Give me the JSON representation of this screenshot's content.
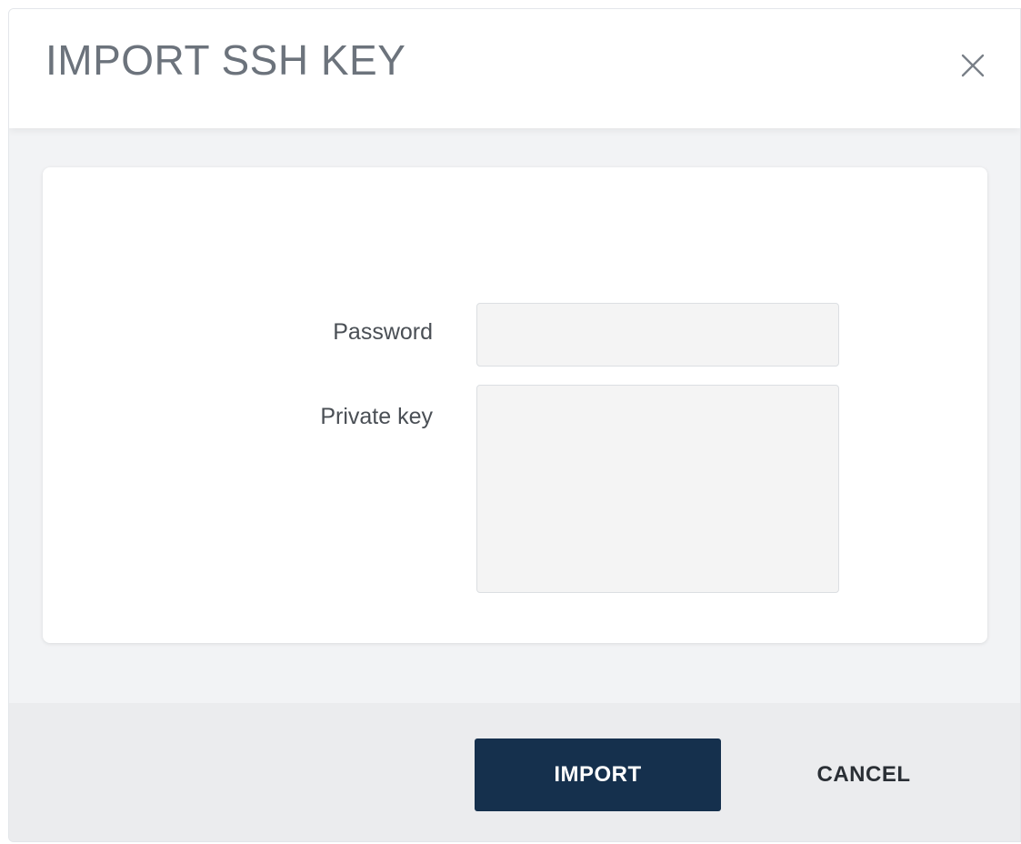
{
  "dialog": {
    "title": "IMPORT SSH KEY",
    "close_icon": "close-icon"
  },
  "form": {
    "password": {
      "label": "Password",
      "value": "",
      "placeholder": ""
    },
    "private_key": {
      "label": "Private key",
      "value": "",
      "placeholder": ""
    }
  },
  "footer": {
    "import_label": "IMPORT",
    "cancel_label": "CANCEL"
  },
  "colors": {
    "primary_button": "#15304d",
    "title_text": "#6c737c",
    "footer_background": "#ebecee",
    "input_background": "#f4f4f4"
  }
}
